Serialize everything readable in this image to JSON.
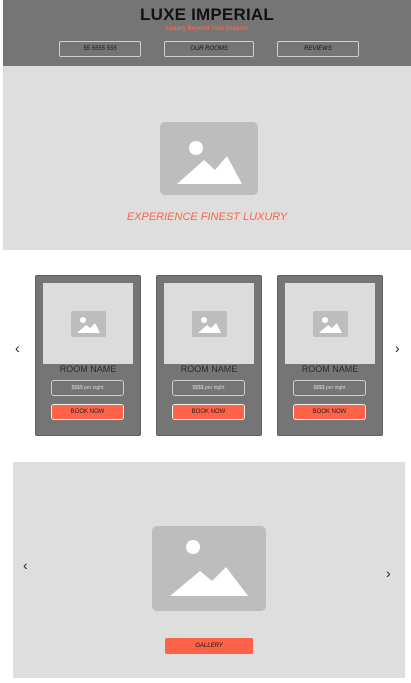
{
  "header": {
    "brand": "LUXE IMPERIAL",
    "tagline": "Luxury Beyond Your Dreams",
    "nav": [
      "55 5555 555",
      "OUR ROOMS",
      "REVIEWS"
    ]
  },
  "hero": {
    "caption": "EXPERIENCE FINEST LUXURY"
  },
  "rooms": {
    "prev_arrow": "‹",
    "next_arrow": "›",
    "items": [
      {
        "name": "ROOM NAME",
        "price": "$$$$ per night",
        "book": "BOOK NOW"
      },
      {
        "name": "ROOM NAME",
        "price": "$$$$ per night",
        "book": "BOOK NOW"
      },
      {
        "name": "ROOM NAME",
        "price": "$$$$ per night",
        "book": "BOOK NOW"
      }
    ]
  },
  "gallery": {
    "prev_arrow": "‹",
    "next_arrow": "›",
    "button": "GALLERY"
  },
  "colors": {
    "accent": "#ff6347",
    "header_bg": "#757575",
    "panel_bg": "#dedede",
    "placeholder": "#bdbdbd"
  }
}
